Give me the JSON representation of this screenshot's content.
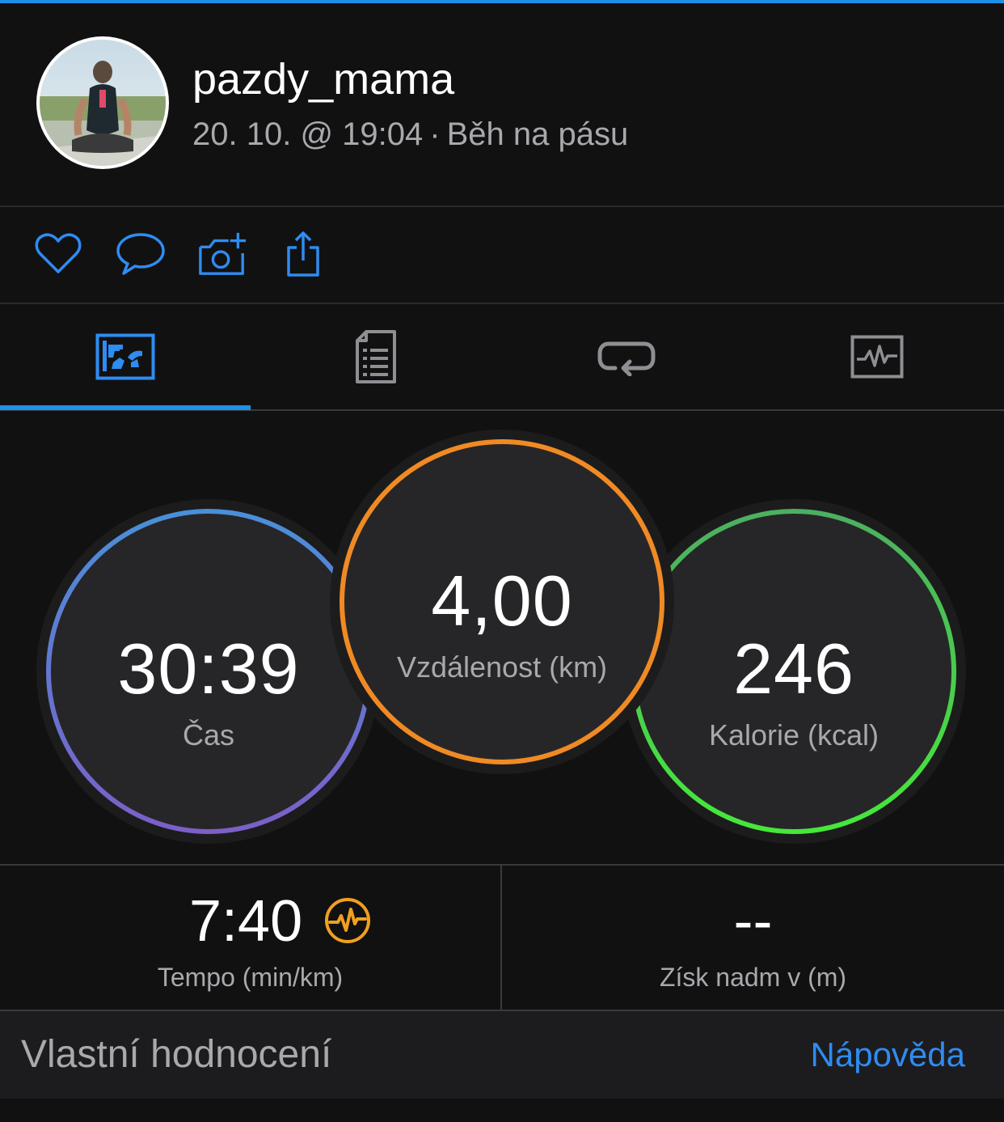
{
  "profile": {
    "username": "pazdy_mama",
    "date_time": "20. 10. @ 19:04",
    "separator": "·",
    "activity_type": "Běh na pásu"
  },
  "actions": [
    {
      "name": "like",
      "icon": "heart-icon"
    },
    {
      "name": "comment",
      "icon": "comment-icon"
    },
    {
      "name": "add-photo",
      "icon": "camera-add-icon"
    },
    {
      "name": "share",
      "icon": "share-icon"
    }
  ],
  "tabs": [
    {
      "name": "overview",
      "icon": "overview-icon",
      "selected": true
    },
    {
      "name": "details",
      "icon": "document-icon",
      "selected": false
    },
    {
      "name": "laps",
      "icon": "loop-icon",
      "selected": false
    },
    {
      "name": "charts",
      "icon": "chart-icon",
      "selected": false
    }
  ],
  "rings": {
    "time": {
      "value": "30:39",
      "label": "Čas",
      "color_top": "#4a8fd8",
      "color_bottom": "#7c5fc8"
    },
    "distance": {
      "value": "4,00",
      "label": "Vzdálenost (km)",
      "color": "#f08a24"
    },
    "calories": {
      "value": "246",
      "label": "Kalorie (kcal)",
      "color_top": "#4caf60",
      "color_bottom": "#46e83a"
    }
  },
  "stats": {
    "pace": {
      "value": "7:40",
      "label": "Tempo (min/km)",
      "icon": "heart-rate-icon",
      "icon_color": "#f0a020"
    },
    "elevation": {
      "value": "--",
      "label": "Získ nadm v (m)"
    }
  },
  "footer": {
    "title": "Vlastní hodnocení",
    "help_link": "Nápověda"
  },
  "colors": {
    "accent": "#1e90e6",
    "link": "#2f8cf0"
  }
}
